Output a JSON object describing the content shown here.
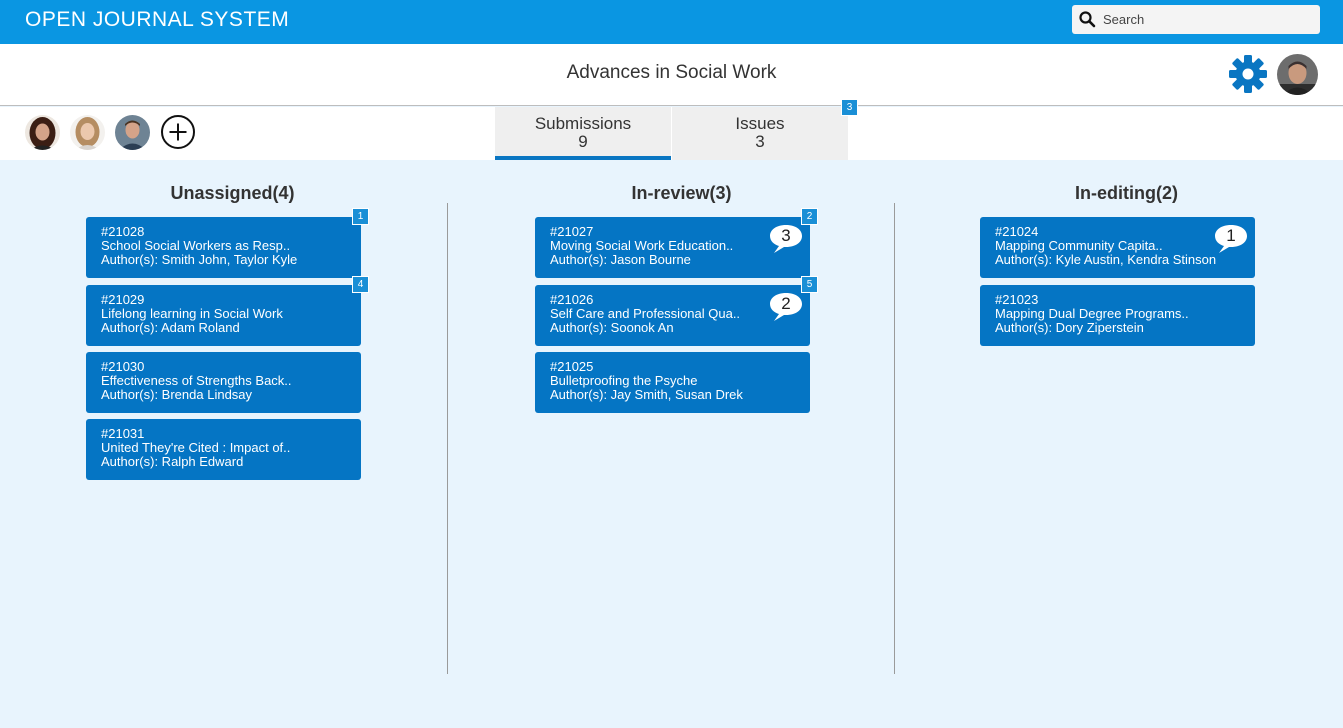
{
  "app": {
    "title": "OPEN JOURNAL SYSTEM"
  },
  "search": {
    "placeholder": "Search",
    "value": ""
  },
  "header": {
    "title": "Advances in Social Work"
  },
  "tabs": [
    {
      "label": "Submissions",
      "count": "9",
      "active": true
    },
    {
      "label": "Issues",
      "count": "3",
      "badge": "3"
    }
  ],
  "columns": [
    {
      "title": "Unassigned(4)",
      "cards": [
        {
          "id": "#21028",
          "title": "School Social Workers as Resp..",
          "authors": "Author(s): Smith John, Taylor Kyle",
          "badge": "1"
        },
        {
          "id": "#21029",
          "title": "Lifelong learning in Social Work",
          "authors": "Author(s): Adam Roland",
          "badge": "4"
        },
        {
          "id": "#21030",
          "title": "Effectiveness of Strengths Back..",
          "authors": "Author(s): Brenda Lindsay"
        },
        {
          "id": "#21031",
          "title": "United They're Cited : Impact of..",
          "authors": "Author(s): Ralph Edward"
        }
      ]
    },
    {
      "title": "In-review(3)",
      "cards": [
        {
          "id": "#21027",
          "title": "Moving Social Work Education..",
          "authors": "Author(s): Jason Bourne",
          "badge": "2",
          "comments": "3"
        },
        {
          "id": "#21026",
          "title": "Self Care and Professional Qua..",
          "authors": "Author(s): Soonok An",
          "badge": "5",
          "comments": "2"
        },
        {
          "id": "#21025",
          "title": "Bulletproofing the Psyche",
          "authors": "Author(s): Jay Smith, Susan Drek"
        }
      ]
    },
    {
      "title": "In-editing(2)",
      "cards": [
        {
          "id": "#21024",
          "title": "Mapping Community Capita..",
          "authors": "Author(s): Kyle Austin, Kendra Stinson",
          "comments": "1"
        },
        {
          "id": "#21023",
          "title": "Mapping Dual Degree Programs..",
          "authors": "Author(s): Dory Ziperstein"
        }
      ]
    }
  ],
  "icons": {
    "search": "search-icon",
    "settings": "gear-icon",
    "add_member": "plus-circle-icon",
    "comment": "speech-bubble-icon"
  },
  "colors": {
    "topbar": "#0a96e2",
    "card": "#0575c4",
    "badge": "#1a8fd6",
    "board_bg": "#e8f4fd"
  }
}
